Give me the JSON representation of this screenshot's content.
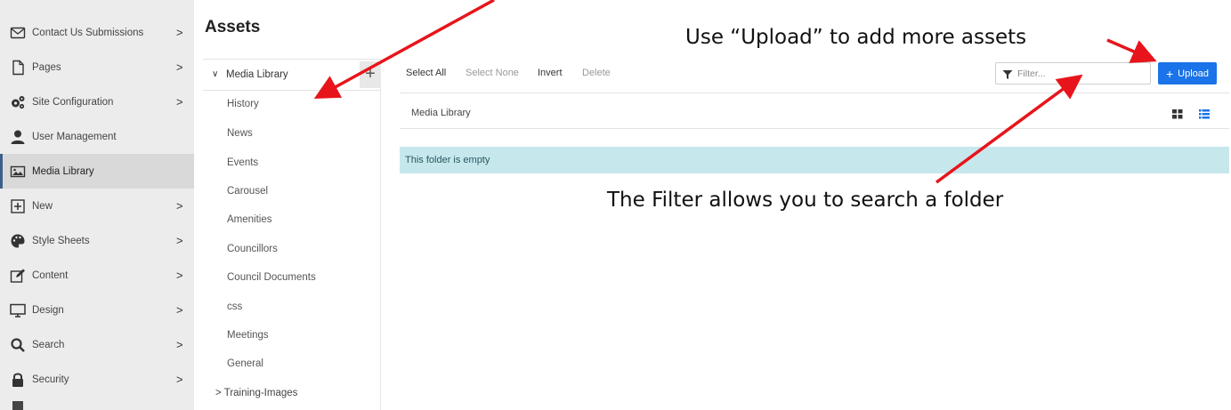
{
  "sidebar": {
    "items": [
      {
        "label": "Contact Us Submissions",
        "icon": "envelope-icon",
        "chevron": ">"
      },
      {
        "label": "Pages",
        "icon": "page-icon",
        "chevron": ">"
      },
      {
        "label": "Site Configuration",
        "icon": "gears-icon",
        "chevron": ">"
      },
      {
        "label": "User Management",
        "icon": "user-icon",
        "chevron": ""
      },
      {
        "label": "Media Library",
        "icon": "image-icon",
        "chevron": ""
      },
      {
        "label": "New",
        "icon": "plus-square-icon",
        "chevron": ">"
      },
      {
        "label": "Style Sheets",
        "icon": "palette-icon",
        "chevron": ">"
      },
      {
        "label": "Content",
        "icon": "edit-icon",
        "chevron": ">"
      },
      {
        "label": "Design",
        "icon": "monitor-icon",
        "chevron": ">"
      },
      {
        "label": "Search",
        "icon": "search-icon",
        "chevron": ">"
      },
      {
        "label": "Security",
        "icon": "lock-icon",
        "chevron": ">"
      }
    ],
    "active_item": "Media Library"
  },
  "page_title": "Assets",
  "folders": {
    "root_caret": "∨",
    "root_label": "Media Library",
    "add_label": "+",
    "items": [
      "History",
      "News",
      "Events",
      "Carousel",
      "Amenities",
      "Councillors",
      "Council Documents",
      "css",
      "Meetings",
      "General"
    ],
    "expandable": {
      "caret": ">",
      "label": "Training-Images"
    }
  },
  "toolbar": {
    "select_all": "Select All",
    "select_none": "Select None",
    "invert": "Invert",
    "delete": "Delete"
  },
  "filter": {
    "placeholder": "Filter...",
    "value": ""
  },
  "upload": {
    "plus": "+",
    "label": "Upload"
  },
  "breadcrumb": {
    "label": "Media Library"
  },
  "empty_message": "This folder is empty",
  "annotations": {
    "upload_note": "Use “Upload” to add more assets",
    "filter_note": "The Filter allows you to search a folder"
  },
  "colors": {
    "accent": "#1a73e8",
    "empty_bg": "#c6e8ec",
    "arrow": "#e8141b",
    "sidebar_bg": "#ececec"
  }
}
